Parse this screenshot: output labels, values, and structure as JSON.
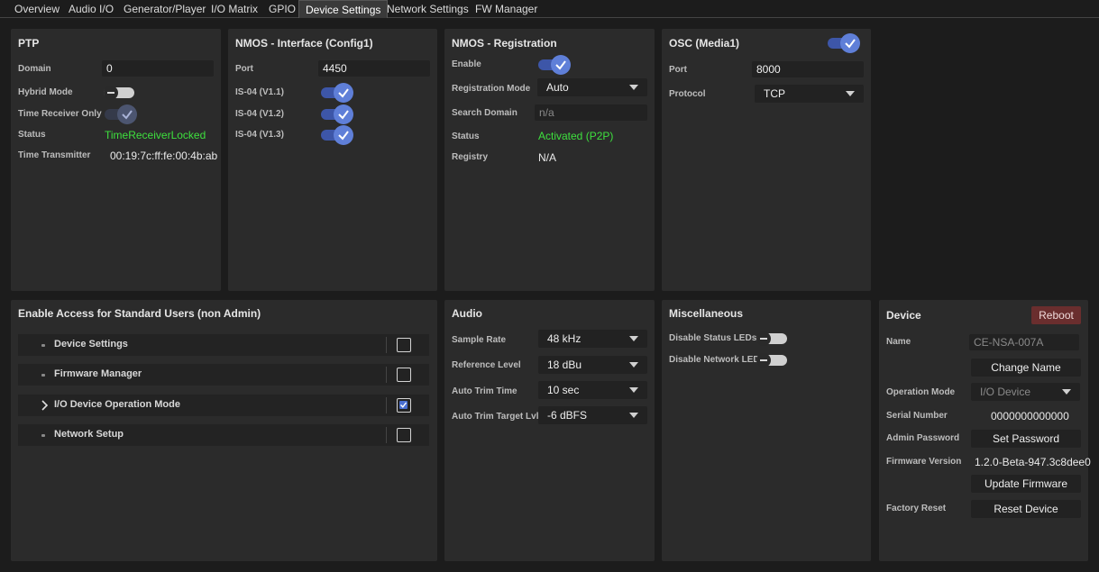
{
  "tabs": [
    "Overview",
    "Audio I/O",
    "Generator/Player",
    "I/O Matrix",
    "GPIO",
    "Device Settings",
    "Network Settings",
    "FW Manager"
  ],
  "active_tab": "Device Settings",
  "ptp": {
    "title": "PTP",
    "domain_label": "Domain",
    "domain_value": "0",
    "hybrid_label": "Hybrid Mode",
    "time_receiver_label": "Time Receiver Only",
    "status_label": "Status",
    "status_value": "TimeReceiverLocked",
    "transmitter_label": "Time Transmitter",
    "transmitter_value": "00:19:7c:ff:fe:00:4b:ab"
  },
  "nmos_interface": {
    "title": "NMOS - Interface (Config1)",
    "port_label": "Port",
    "port_value": "4450",
    "is04_v11": "IS-04 (V1.1)",
    "is04_v12": "IS-04 (V1.2)",
    "is04_v13": "IS-04 (V1.3)"
  },
  "nmos_registration": {
    "title": "NMOS - Registration",
    "enable_label": "Enable",
    "mode_label": "Registration Mode",
    "mode_value": "Auto",
    "search_label": "Search Domain",
    "search_value": "n/a",
    "status_label": "Status",
    "status_value": "Activated (P2P)",
    "registry_label": "Registry",
    "registry_value": "N/A"
  },
  "osc": {
    "title": "OSC (Media1)",
    "port_label": "Port",
    "port_value": "8000",
    "protocol_label": "Protocol",
    "protocol_value": "TCP"
  },
  "access": {
    "title": "Enable Access for Standard Users (non Admin)",
    "items": [
      {
        "label": "Device Settings",
        "checked": false
      },
      {
        "label": "Firmware Manager",
        "checked": false
      },
      {
        "label": "I/O Device Operation Mode",
        "checked": true
      },
      {
        "label": "Network Setup",
        "checked": false
      }
    ]
  },
  "audio": {
    "title": "Audio",
    "sample_rate_label": "Sample Rate",
    "sample_rate_value": "48 kHz",
    "ref_level_label": "Reference Level",
    "ref_level_value": "18 dBu",
    "trim_time_label": "Auto Trim Time",
    "trim_time_value": "10 sec",
    "trim_target_label": "Auto Trim Target Lvl",
    "trim_target_value": "-6 dBFS"
  },
  "misc": {
    "title": "Miscellaneous",
    "status_leds_label": "Disable Status LEDs",
    "network_leds_label": "Disable Network LEDs"
  },
  "device": {
    "title": "Device",
    "reboot_label": "Reboot",
    "name_label": "Name",
    "name_value": "CE-NSA-007A",
    "change_name_label": "Change Name",
    "op_mode_label": "Operation Mode",
    "op_mode_value": "I/O Device",
    "serial_label": "Serial Number",
    "serial_value": "0000000000000",
    "admin_pw_label": "Admin Password",
    "set_password_label": "Set Password",
    "firmware_label": "Firmware Version",
    "firmware_value": "1.2.0-Beta-947.3c8dee0",
    "update_firmware_label": "Update Firmware",
    "factory_reset_label": "Factory Reset",
    "reset_device_label": "Reset Device"
  },
  "colors": {
    "accent": "#5f7fd8",
    "status_ok": "#3ee03e",
    "reboot_bg": "#6a2e2e"
  }
}
